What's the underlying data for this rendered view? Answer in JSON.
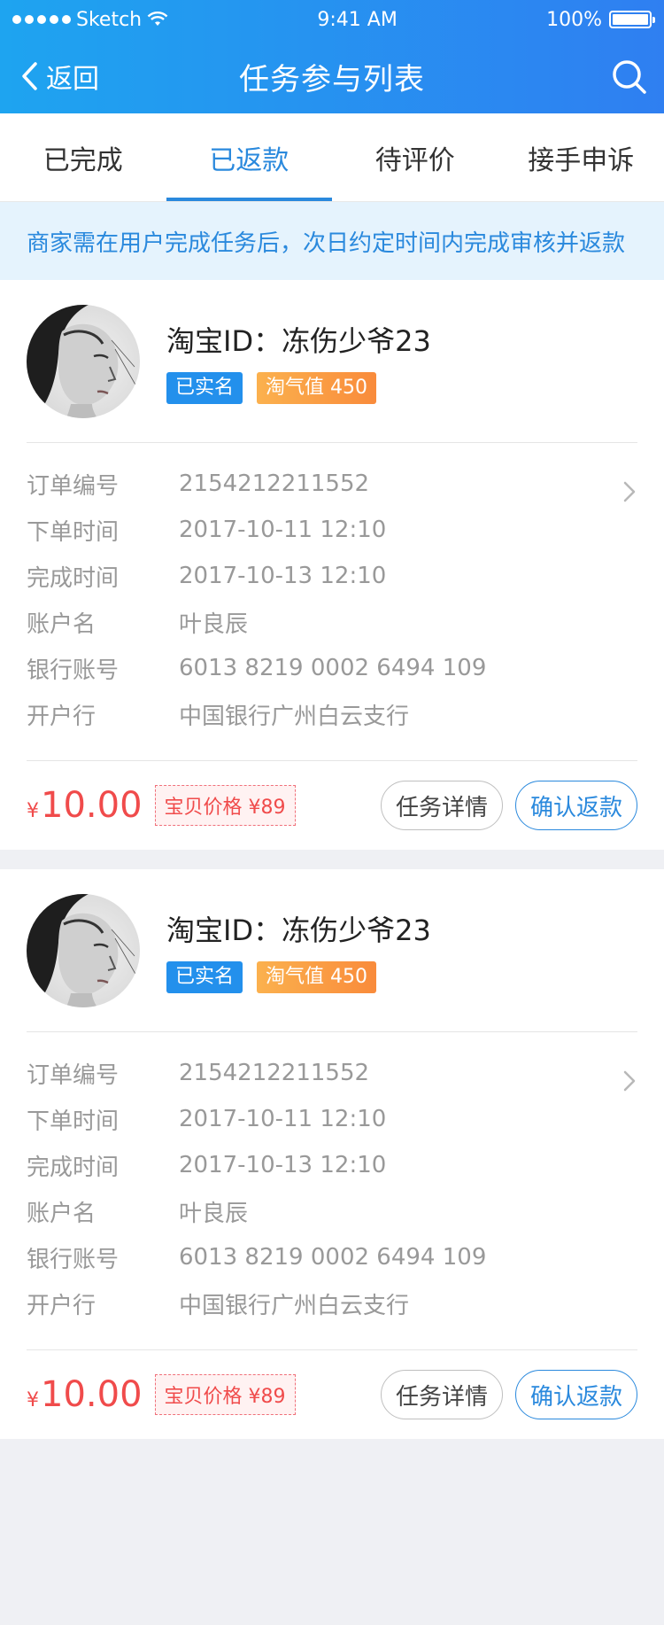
{
  "status_bar": {
    "carrier": "Sketch",
    "time": "9:41 AM",
    "battery": "100%"
  },
  "nav": {
    "back_label": "返回",
    "title": "任务参与列表"
  },
  "tabs": [
    {
      "label": "已完成",
      "active": false
    },
    {
      "label": "已返款",
      "active": true
    },
    {
      "label": "待评价",
      "active": false
    },
    {
      "label": "接手申诉",
      "active": false
    }
  ],
  "notice": "商家需在用户完成任务后，次日约定时间内完成审核并返款",
  "colors": {
    "accent": "#2a89dd",
    "price": "#f04b4b"
  },
  "cards": [
    {
      "user": "淘宝ID：冻伤少爷23",
      "badges": {
        "verified": "已实名",
        "score": "淘气值 450"
      },
      "rows": [
        {
          "k": "订单编号",
          "v": "2154212211552"
        },
        {
          "k": "下单时间",
          "v": "2017-10-11 12:10"
        },
        {
          "k": "完成时间",
          "v": "2017-10-13 12:10"
        },
        {
          "k": "账户名",
          "v": "叶良辰"
        },
        {
          "k": "银行账号",
          "v": "6013 8219 0002 6494 109"
        },
        {
          "k": "开户行",
          "v": "中国银行广州白云支行"
        }
      ],
      "currency": "¥",
      "amount": "10.00",
      "goods_price": "宝贝价格 ¥89",
      "btn_detail": "任务详情",
      "btn_confirm": "确认返款"
    },
    {
      "user": "淘宝ID：冻伤少爷23",
      "badges": {
        "verified": "已实名",
        "score": "淘气值 450"
      },
      "rows": [
        {
          "k": "订单编号",
          "v": "2154212211552"
        },
        {
          "k": "下单时间",
          "v": "2017-10-11 12:10"
        },
        {
          "k": "完成时间",
          "v": "2017-10-13 12:10"
        },
        {
          "k": "账户名",
          "v": "叶良辰"
        },
        {
          "k": "银行账号",
          "v": "6013 8219 0002 6494 109"
        },
        {
          "k": "开户行",
          "v": "中国银行广州白云支行"
        }
      ],
      "currency": "¥",
      "amount": "10.00",
      "goods_price": "宝贝价格 ¥89",
      "btn_detail": "任务详情",
      "btn_confirm": "确认返款"
    }
  ]
}
